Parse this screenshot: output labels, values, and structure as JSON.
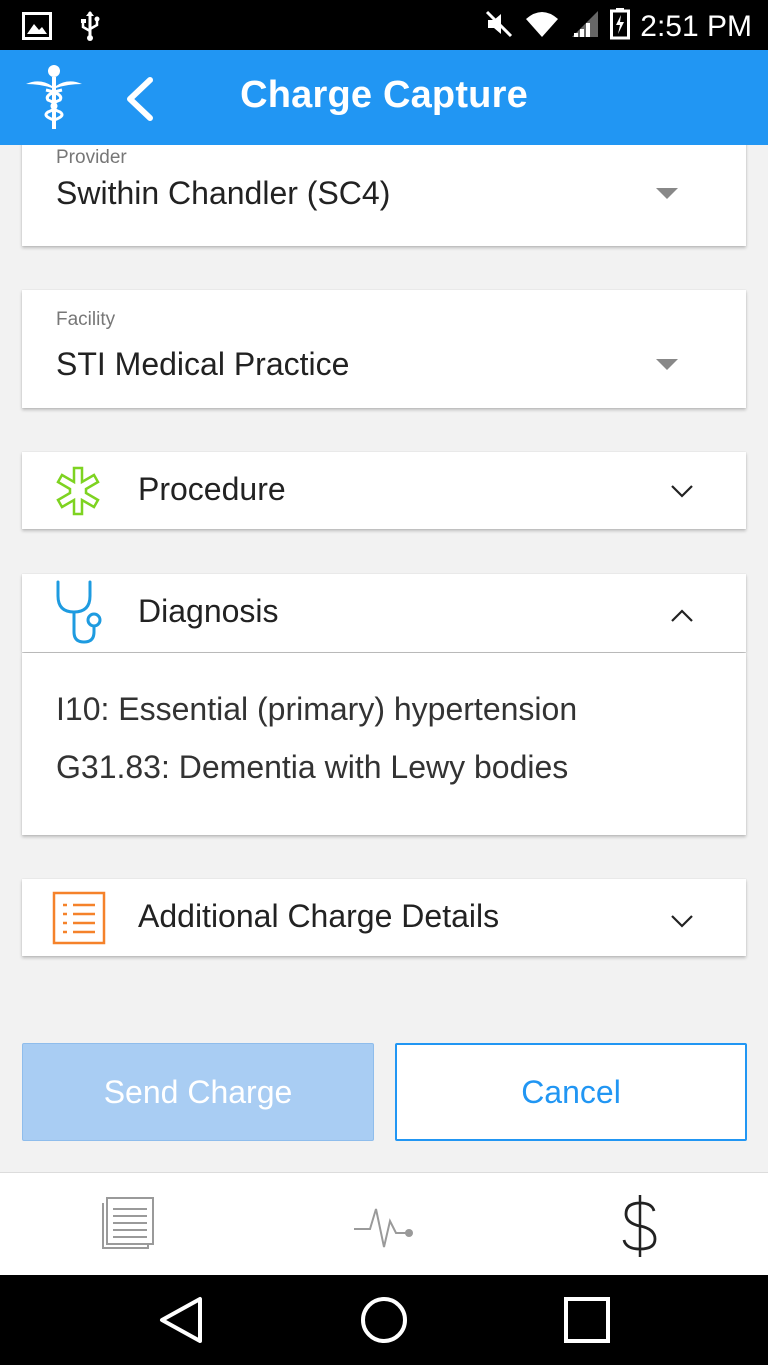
{
  "status_bar": {
    "time": "2:51 PM",
    "left_icons": [
      "image-notification-icon",
      "usb-icon"
    ],
    "right_icons": [
      "muted-icon",
      "wifi-icon",
      "signal-icon",
      "battery-charging-icon"
    ]
  },
  "app_bar": {
    "title": "Charge Capture",
    "logo_icon": "caduceus-icon",
    "back_icon": "back-chevron-icon",
    "color": "#2196f3"
  },
  "provider": {
    "label": "Provider",
    "value": "Swithin Chandler (SC4)"
  },
  "facility": {
    "label": "Facility",
    "value": "STI Medical Practice"
  },
  "procedure": {
    "title": "Procedure",
    "icon": "asterisk-icon",
    "icon_color": "#7ed321",
    "expanded": false
  },
  "diagnosis": {
    "title": "Diagnosis",
    "icon": "stethoscope-icon",
    "icon_color": "#1e9be0",
    "expanded": true,
    "items": [
      "I10: Essential (primary) hypertension",
      "G31.83: Dementia with Lewy bodies"
    ]
  },
  "additional": {
    "title": "Additional Charge Details",
    "icon": "list-icon",
    "icon_color": "#f5822a",
    "expanded": false
  },
  "actions": {
    "send_label": "Send Charge",
    "cancel_label": "Cancel",
    "send_enabled": false
  },
  "bottom_nav": {
    "items": [
      "document-icon",
      "vitals-icon",
      "dollar-icon"
    ]
  },
  "system_nav": {
    "items": [
      "back-triangle-icon",
      "home-circle-icon",
      "recents-square-icon"
    ]
  }
}
